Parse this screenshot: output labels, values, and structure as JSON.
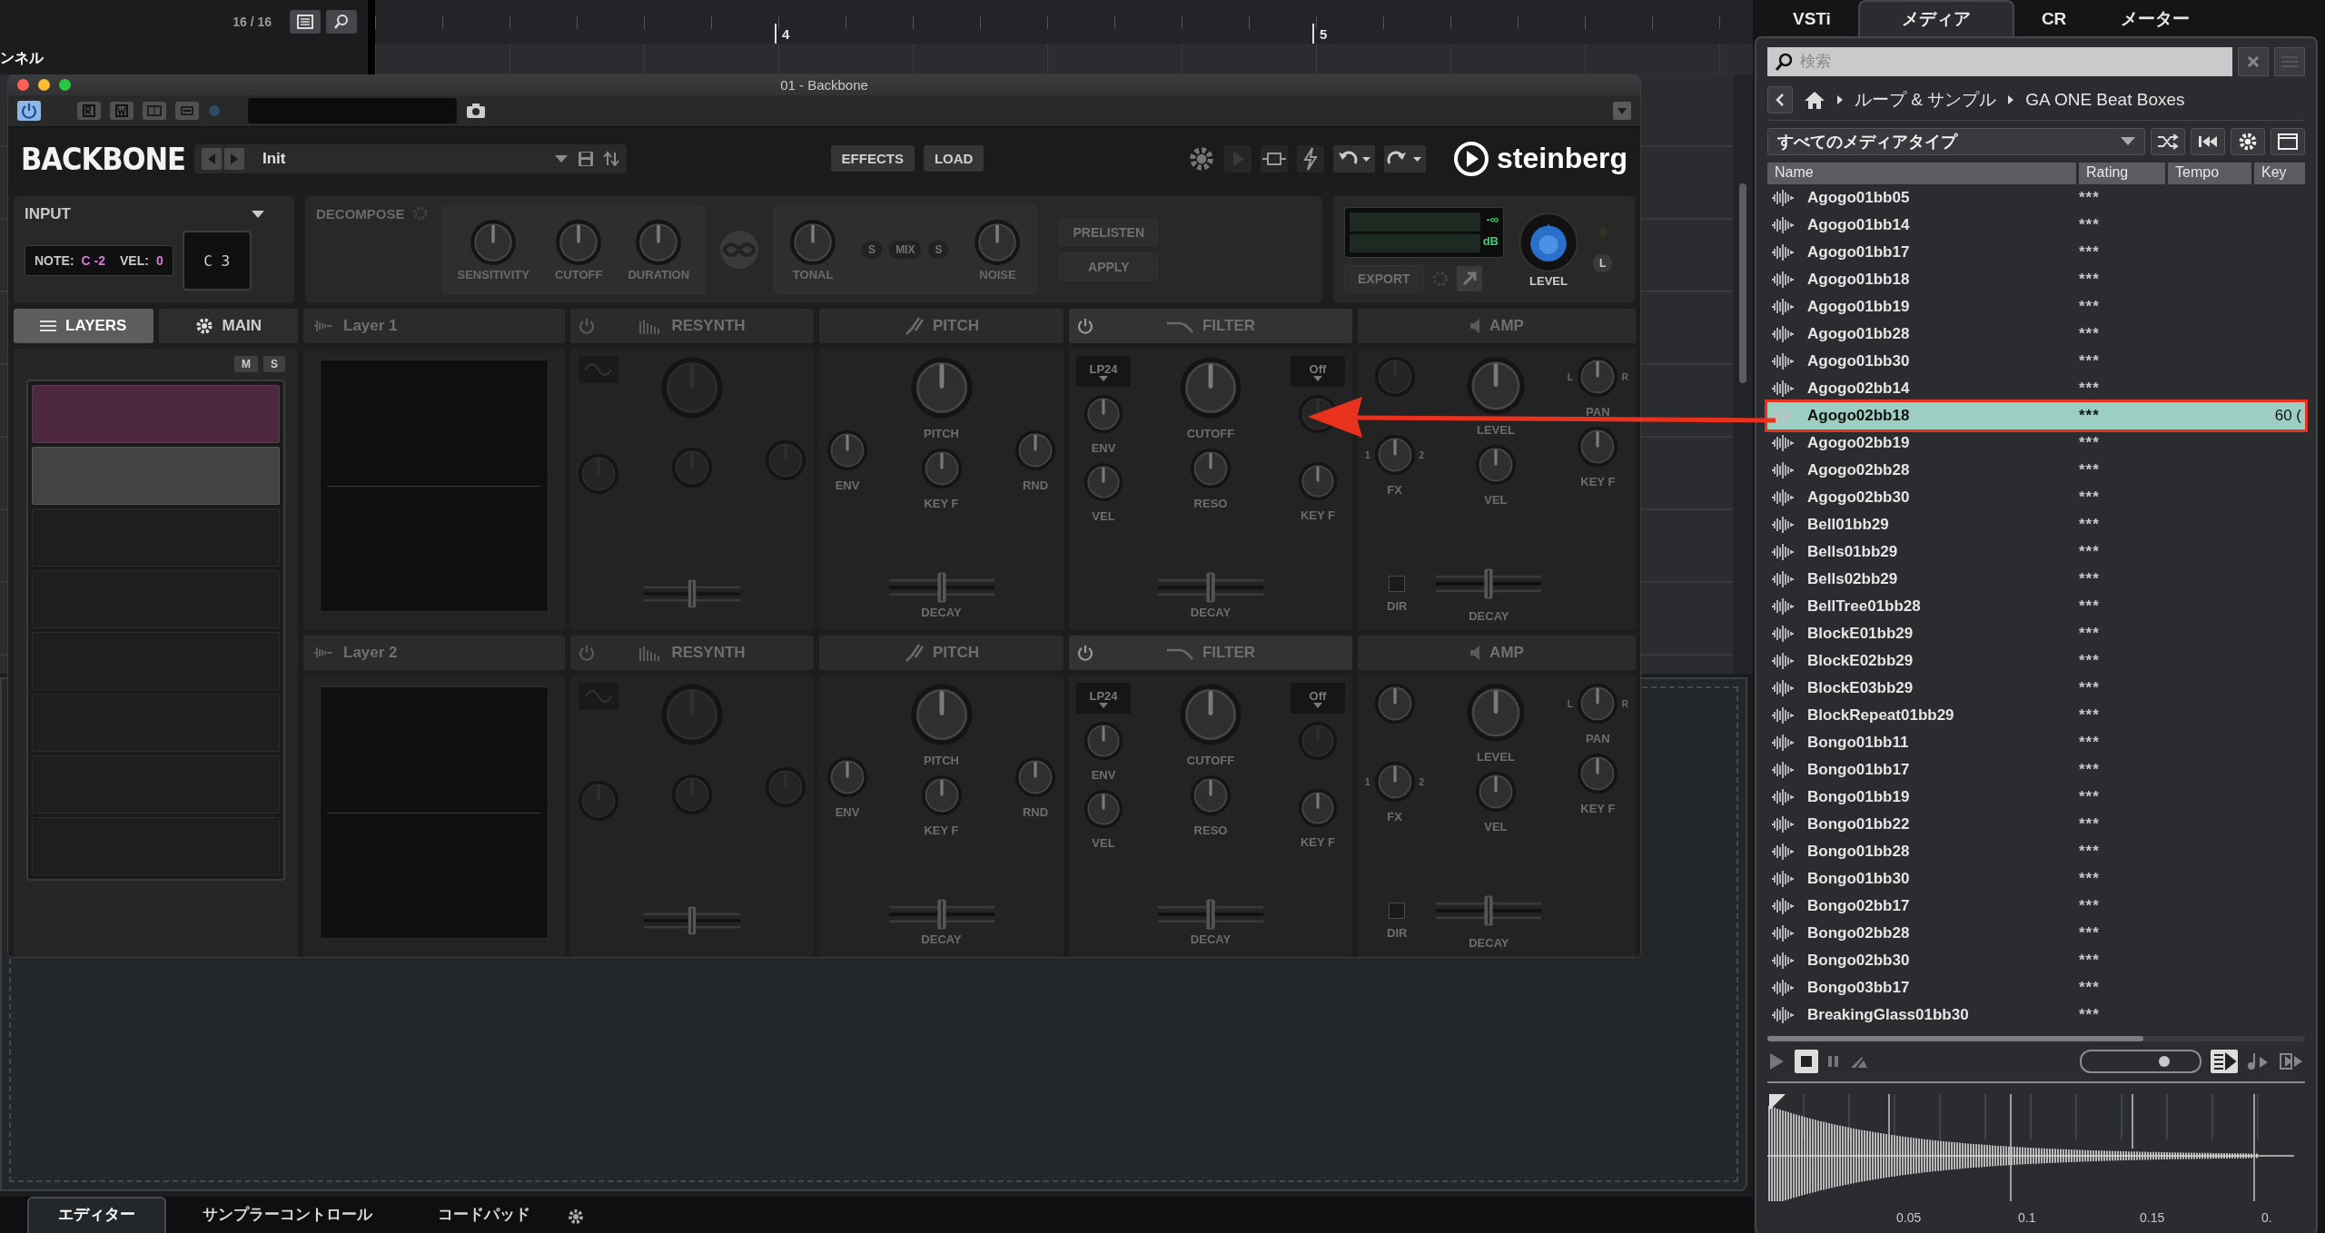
{
  "daw": {
    "counter": "16 / 16",
    "ruler_marks": [
      "4",
      "5"
    ],
    "track_label": "ンネル",
    "bottom_tabs": [
      {
        "label": "エディター",
        "selected": true
      },
      {
        "label": "サンプラーコントロール",
        "selected": false
      },
      {
        "label": "コードパッド",
        "selected": false
      }
    ]
  },
  "plugin": {
    "title": "01 - Backbone",
    "logo": "BACKBONE",
    "preset": "Init",
    "header_buttons": [
      "EFFECTS",
      "LOAD"
    ],
    "brand": "steinberg",
    "input": {
      "title": "INPUT",
      "note_label": "NOTE:",
      "note": "C -2",
      "vel_label": "VEL:",
      "vel": "0",
      "key": "C 3"
    },
    "decompose": {
      "title": "DECOMPOSE",
      "knobs": [
        "SENSITIVITY",
        "CUTOFF",
        "DURATION"
      ],
      "tonal": "TONAL",
      "mix": [
        "S",
        "MIX",
        "S"
      ],
      "noise": "NOISE",
      "buttons": [
        "PRELISTEN",
        "APPLY"
      ]
    },
    "output": {
      "meter_value": "-∞",
      "meter_unit": "dB",
      "export": "EXPORT",
      "level_label": "LEVEL",
      "channel": "L"
    },
    "tabs": [
      {
        "label": "LAYERS",
        "selected": true
      },
      {
        "label": "MAIN",
        "selected": false
      }
    ],
    "layer_list": {
      "mute": "M",
      "solo": "S",
      "slots": [
        {
          "kind": "active"
        },
        {
          "kind": "selected"
        },
        {
          "kind": "empty"
        },
        {
          "kind": "empty"
        },
        {
          "kind": "empty"
        },
        {
          "kind": "empty"
        },
        {
          "kind": "empty"
        },
        {
          "kind": "empty"
        }
      ]
    },
    "layers": [
      {
        "name": "Layer 1",
        "resynth": {
          "title": "RESYNTH",
          "level": 0.5
        },
        "pitch": {
          "title": "PITCH",
          "knobs": [
            "ENV",
            "PITCH",
            "RND",
            "KEY F"
          ],
          "slider": {
            "label": "DECAY",
            "level": 0.5
          }
        },
        "filter": {
          "title": "FILTER",
          "type": "LP24",
          "mode": "Off",
          "knobs": [
            "ENV",
            "CUTOFF",
            "VEL",
            "RESO",
            "KEY F"
          ],
          "slider": {
            "label": "DECAY",
            "level": 0.5
          }
        },
        "amp": {
          "title": "AMP",
          "knobs": [
            "LEVEL",
            "PAN",
            "FX",
            "VEL",
            "KEY F"
          ],
          "pan_ends": [
            "L",
            "R"
          ],
          "fx_ends": [
            "1",
            "2"
          ],
          "dir": {
            "label": "DIR",
            "checked": false
          },
          "slider": {
            "label": "DECAY",
            "level": 0.5
          }
        }
      },
      {
        "name": "Layer 2",
        "resynth": {
          "title": "RESYNTH",
          "level": 0.5
        },
        "pitch": {
          "title": "PITCH",
          "knobs": [
            "ENV",
            "PITCH",
            "RND",
            "KEY F"
          ],
          "slider": {
            "label": "DECAY",
            "level": 0.5
          }
        },
        "filter": {
          "title": "FILTER",
          "type": "LP24",
          "mode": "Off",
          "knobs": [
            "ENV",
            "CUTOFF",
            "VEL",
            "RESO",
            "KEY F"
          ],
          "slider": {
            "label": "DECAY",
            "level": 0.5
          }
        },
        "amp": {
          "title": "AMP",
          "knobs": [
            "LEVEL",
            "PAN",
            "FX",
            "VEL",
            "KEY F"
          ],
          "pan_ends": [
            "L",
            "R"
          ],
          "fx_ends": [
            "1",
            "2"
          ],
          "dir": {
            "label": "DIR",
            "checked": false
          },
          "slider": {
            "label": "DECAY",
            "level": 0.5
          }
        }
      }
    ]
  },
  "media_panel": {
    "tabs": [
      {
        "label": "VSTi",
        "selected": false
      },
      {
        "label": "メディア",
        "selected": true
      },
      {
        "label": "CR",
        "selected": false
      },
      {
        "label": "メーター",
        "selected": false
      }
    ],
    "search": {
      "placeholder": "検索"
    },
    "breadcrumb": [
      "ループ & サンプル",
      "GA ONE Beat Boxes"
    ],
    "media_type": "すべてのメディアタイプ",
    "columns": [
      "Name",
      "Rating",
      "Tempo",
      "Key"
    ],
    "rows": [
      {
        "name": "Agogo01bb05",
        "rating": "***",
        "selected": false
      },
      {
        "name": "Agogo01bb14",
        "rating": "***",
        "selected": false
      },
      {
        "name": "Agogo01bb17",
        "rating": "***",
        "selected": false
      },
      {
        "name": "Agogo01bb18",
        "rating": "***",
        "selected": false
      },
      {
        "name": "Agogo01bb19",
        "rating": "***",
        "selected": false
      },
      {
        "name": "Agogo01bb28",
        "rating": "***",
        "selected": false
      },
      {
        "name": "Agogo01bb30",
        "rating": "***",
        "selected": false
      },
      {
        "name": "Agogo02bb14",
        "rating": "***",
        "selected": false
      },
      {
        "name": "Agogo02bb18",
        "rating": "***",
        "key": "60 (",
        "selected": true
      },
      {
        "name": "Agogo02bb19",
        "rating": "***",
        "selected": false
      },
      {
        "name": "Agogo02bb28",
        "rating": "***",
        "selected": false
      },
      {
        "name": "Agogo02bb30",
        "rating": "***",
        "selected": false
      },
      {
        "name": "Bell01bb29",
        "rating": "***",
        "selected": false
      },
      {
        "name": "Bells01bb29",
        "rating": "***",
        "selected": false
      },
      {
        "name": "Bells02bb29",
        "rating": "***",
        "selected": false
      },
      {
        "name": "BellTree01bb28",
        "rating": "***",
        "selected": false
      },
      {
        "name": "BlockE01bb29",
        "rating": "***",
        "selected": false
      },
      {
        "name": "BlockE02bb29",
        "rating": "***",
        "selected": false
      },
      {
        "name": "BlockE03bb29",
        "rating": "***",
        "selected": false
      },
      {
        "name": "BlockRepeat01bb29",
        "rating": "***",
        "selected": false
      },
      {
        "name": "Bongo01bb11",
        "rating": "***",
        "selected": false
      },
      {
        "name": "Bongo01bb17",
        "rating": "***",
        "selected": false
      },
      {
        "name": "Bongo01bb19",
        "rating": "***",
        "selected": false
      },
      {
        "name": "Bongo01bb22",
        "rating": "***",
        "selected": false
      },
      {
        "name": "Bongo01bb28",
        "rating": "***",
        "selected": false
      },
      {
        "name": "Bongo01bb30",
        "rating": "***",
        "selected": false
      },
      {
        "name": "Bongo02bb17",
        "rating": "***",
        "selected": false
      },
      {
        "name": "Bongo02bb28",
        "rating": "***",
        "selected": false
      },
      {
        "name": "Bongo02bb30",
        "rating": "***",
        "selected": false
      },
      {
        "name": "Bongo03bb17",
        "rating": "***",
        "selected": false
      },
      {
        "name": "BreakingGlass01bb30",
        "rating": "***",
        "selected": false
      }
    ],
    "preview": {
      "volume": {
        "level": 0.7
      },
      "time_labels": [
        "0.05",
        "0.1",
        "0.15",
        "0."
      ]
    }
  }
}
